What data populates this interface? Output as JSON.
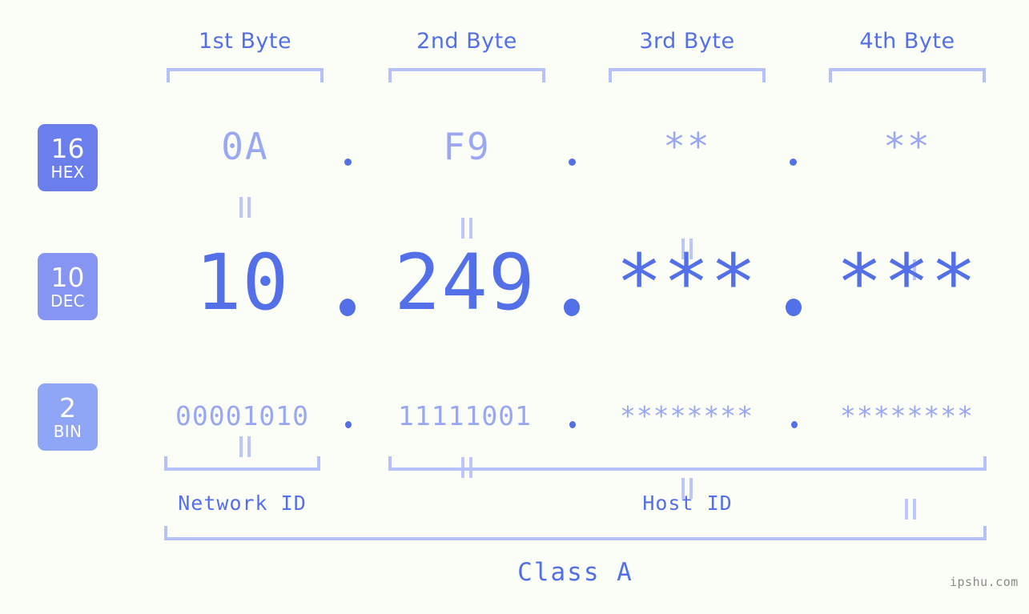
{
  "meta": {
    "background_color": "#fbfdf7",
    "accent_color": "#5470e8",
    "muted_accent_color": "#9aa8f2",
    "bracket_color": "#b6c0fb",
    "watermark": "ipshu.com"
  },
  "byte_headers": [
    {
      "label": "1st Byte"
    },
    {
      "label": "2nd Byte"
    },
    {
      "label": "3rd Byte"
    },
    {
      "label": "4th Byte"
    }
  ],
  "bases": [
    {
      "number": "16",
      "name": "HEX",
      "color": "#6b7fec"
    },
    {
      "number": "10",
      "name": "DEC",
      "color": "#8795f2"
    },
    {
      "number": "2",
      "name": "BIN",
      "color": "#8fa5f6"
    }
  ],
  "rows": {
    "hex": {
      "base_number": "16",
      "base_name": "HEX",
      "values": [
        "0A",
        "F9",
        "**",
        "**"
      ],
      "separator": "."
    },
    "dec": {
      "base_number": "10",
      "base_name": "DEC",
      "values": [
        "10",
        "249",
        "***",
        "***"
      ],
      "separator": "."
    },
    "bin": {
      "base_number": "2",
      "base_name": "BIN",
      "values": [
        "00001010",
        "11111001",
        "********",
        "********"
      ],
      "separator": "."
    }
  },
  "equals_symbol": "=",
  "id_sections": [
    {
      "label": "Network ID"
    },
    {
      "label": "Host ID"
    }
  ],
  "class": {
    "label": "Class A"
  }
}
